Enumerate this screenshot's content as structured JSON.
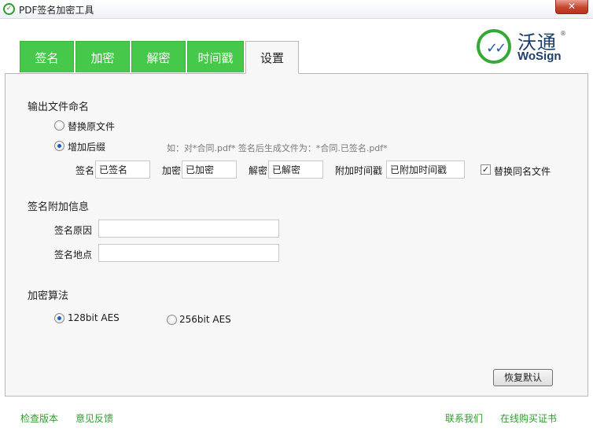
{
  "window": {
    "title": "PDF签名加密工具",
    "close_label": "✕"
  },
  "logo": {
    "cn": "沃通",
    "en": "WoSign",
    "reg": "®"
  },
  "tabs": [
    {
      "label": "签名"
    },
    {
      "label": "加密"
    },
    {
      "label": "解密"
    },
    {
      "label": "时间戳"
    },
    {
      "label": "设置"
    }
  ],
  "output_naming": {
    "title": "输出文件命名",
    "replace_original": "替换原文件",
    "add_suffix": "增加后缀",
    "hint": "如：对*合同.pdf* 签名后生成文件为：*合同.已签名.pdf*",
    "fields": [
      {
        "label": "签名",
        "value": "已签名"
      },
      {
        "label": "加密",
        "value": "已加密"
      },
      {
        "label": "解密",
        "value": "已解密"
      },
      {
        "label": "附加时间戳",
        "value": "已附加时间戳"
      }
    ],
    "replace_same_name": "替换同名文件"
  },
  "sign_info": {
    "title": "签名附加信息",
    "reason_label": "签名原因",
    "reason_value": "",
    "location_label": "签名地点",
    "location_value": ""
  },
  "encryption": {
    "title": "加密算法",
    "option_128": "128bit AES",
    "option_256": "256bit AES"
  },
  "restore_default": "恢复默认",
  "footer": {
    "check_version": "检查版本",
    "feedback": "意见反馈",
    "contact": "联系我们",
    "buy_cert": "在线购买证书"
  }
}
